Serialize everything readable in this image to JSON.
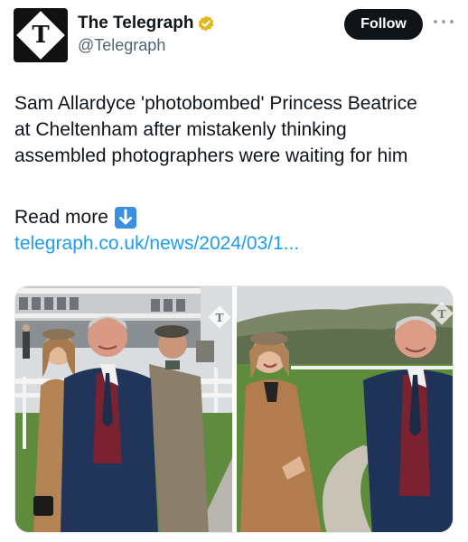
{
  "account": {
    "display_name": "The Telegraph",
    "handle": "@Telegraph",
    "avatar_letter": "T",
    "verified_color": "#e2b719"
  },
  "actions": {
    "follow_label": "Follow",
    "more_icon": "ellipsis-icon"
  },
  "tweet": {
    "text_lines": [
      "Sam Allardyce 'photobombed' Princess Beatrice",
      "at Cheltenham after mistakenly thinking",
      "assembled photographers were waiting for him"
    ],
    "read_more_label": "Read more",
    "read_more_icon": "down-arrow-emoji",
    "link_text": "telegraph.co.uk/news/2024/03/1..."
  },
  "media": {
    "photos": [
      {
        "name": "photo-left",
        "icon": "telegraph-watermark"
      },
      {
        "name": "photo-right",
        "icon": "telegraph-watermark"
      }
    ]
  },
  "colors": {
    "text": "#0f1419",
    "secondary": "#536471",
    "link": "#1d9bf0",
    "button": "#0f1419"
  }
}
